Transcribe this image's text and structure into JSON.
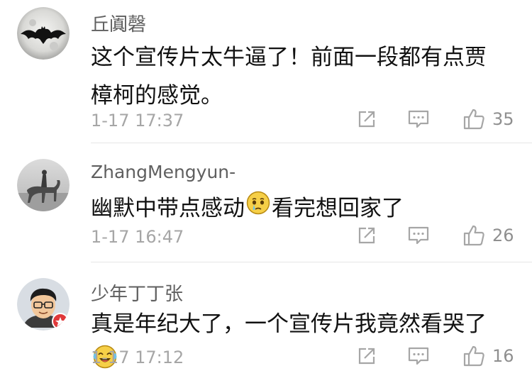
{
  "comments": [
    {
      "username": "丘阗磬",
      "content": "这个宣传片太牛逼了！前面一段都有点贾樟柯的感觉。",
      "timestamp": "1-17 17:37",
      "likes": "35",
      "avatar_icon": "bat-moon-avatar"
    },
    {
      "username": "ZhangMengyun-",
      "content_before": "幽默中带点感动",
      "content_after": "看完想回家了",
      "emoji": "teary-face-emoji",
      "timestamp": "1-17 16:47",
      "likes": "26",
      "avatar_icon": "horse-rider-avatar"
    },
    {
      "username": "少年丁丁张",
      "content": "真是年纪大了，一个宣传片我竟然看哭了",
      "emoji": "crying-laughing-emoji",
      "timestamp": "1-17 17:12",
      "likes": "16",
      "avatar_icon": "cartoon-boy-avatar"
    }
  ],
  "icons": {
    "forward": "forward-icon",
    "reply": "reply-icon",
    "like": "thumbs-up-icon"
  },
  "colors": {
    "username": "#5f5f5f",
    "content": "#111111",
    "meta": "#a6a6a6",
    "divider": "#e6e6e6"
  }
}
